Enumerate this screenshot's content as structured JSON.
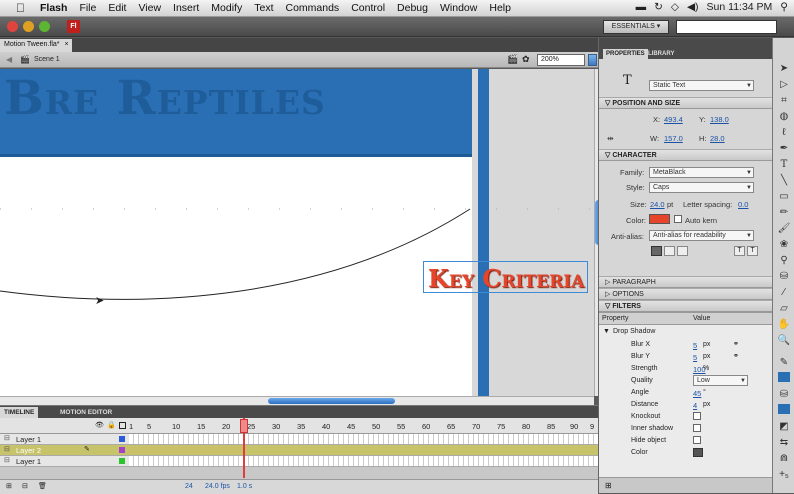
{
  "menubar": {
    "app": "Flash",
    "items": [
      "File",
      "Edit",
      "View",
      "Insert",
      "Modify",
      "Text",
      "Commands",
      "Control",
      "Debug",
      "Window",
      "Help"
    ],
    "clock": "Sun 11:34 PM"
  },
  "appbar": {
    "logo": "Fl",
    "workspace": "ESSENTIALS ▾"
  },
  "document": {
    "tab_label": "Motion Tween.fla*",
    "tab_close": "×",
    "scene": "Scene 1",
    "zoom": "200%"
  },
  "stage": {
    "banner_text": "Bre Reptiles",
    "key_text": "Key Criteria",
    "colors": {
      "banner": "#2a6fb4",
      "key": "#e5452a"
    }
  },
  "timeline": {
    "tabs": [
      "TIMELINE",
      "MOTION EDITOR"
    ],
    "frame_labels": [
      "1",
      "5",
      "10",
      "15",
      "20",
      "25",
      "30",
      "35",
      "40",
      "45",
      "50",
      "55",
      "60",
      "65",
      "70",
      "75",
      "80",
      "85",
      "90",
      "9"
    ],
    "layers": [
      {
        "name": "Layer 1"
      },
      {
        "name": "Layer 2"
      },
      {
        "name": "Layer 1"
      }
    ],
    "current_frame": "24",
    "fps": "24.0 fps",
    "elapsed": "1.0 s"
  },
  "properties": {
    "tabs": [
      "PROPERTIES",
      "LIBRARY"
    ],
    "text_type": "Static Text",
    "position_size": {
      "title": "POSITION AND SIZE",
      "x_label": "X:",
      "x": "493.4",
      "y_label": "Y:",
      "y": "138.0",
      "w_label": "W:",
      "w": "157.0",
      "h_label": "H:",
      "h": "28.0"
    },
    "character": {
      "title": "CHARACTER",
      "family_label": "Family:",
      "family": "MetaBlack",
      "style_label": "Style:",
      "style": "Caps",
      "size_label": "Size:",
      "size": "24.0",
      "size_unit": "pt",
      "spacing_label": "Letter spacing:",
      "spacing": "0.0",
      "color_label": "Color:",
      "auto_kern": "Auto kern",
      "antialias_label": "Anti-alias:",
      "antialias": "Anti-alias for readability",
      "text_color": "#e5452a"
    },
    "sections": [
      "PARAGRAPH",
      "OPTIONS",
      "FILTERS"
    ],
    "filters": {
      "col_property": "Property",
      "col_value": "Value",
      "group": "Drop Shadow",
      "rows": [
        {
          "name": "Blur X",
          "value": "5",
          "unit": "px"
        },
        {
          "name": "Blur Y",
          "value": "5",
          "unit": "px"
        },
        {
          "name": "Strength",
          "value": "100",
          "unit": "%"
        },
        {
          "name": "Quality",
          "value": "Low",
          "unit": ""
        },
        {
          "name": "Angle",
          "value": "45",
          "unit": "°"
        },
        {
          "name": "Distance",
          "value": "4",
          "unit": "px"
        },
        {
          "name": "Knockout",
          "value": "",
          "unit": ""
        },
        {
          "name": "Inner shadow",
          "value": "",
          "unit": ""
        },
        {
          "name": "Hide object",
          "value": "",
          "unit": ""
        },
        {
          "name": "Color",
          "value": "",
          "unit": ""
        }
      ]
    }
  }
}
